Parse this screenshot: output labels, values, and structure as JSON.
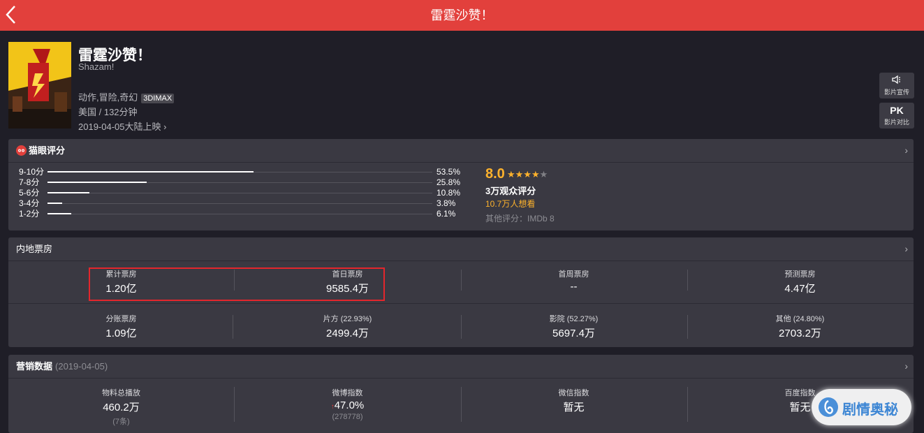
{
  "header": {
    "title": "雷霆沙赞！"
  },
  "movie": {
    "title": "雷霆沙赞！",
    "title_en": "Shazam!",
    "genres": "动作,冒险,奇幻",
    "format_badge": "3DIMAX",
    "country_duration": "美国 / 132分钟",
    "release": "2019-04-05大陆上映 ›"
  },
  "side_buttons": [
    {
      "icon": "🔈",
      "label": "影片宣传"
    },
    {
      "icon": "PK",
      "label": "影片对比"
    }
  ],
  "rating": {
    "section_title": "猫眼评分",
    "distribution": [
      {
        "label": "9-10分",
        "pct": "53.5%",
        "value": 53.5
      },
      {
        "label": "7-8分",
        "pct": "25.8%",
        "value": 25.8
      },
      {
        "label": "5-6分",
        "pct": "10.8%",
        "value": 10.8
      },
      {
        "label": "3-4分",
        "pct": "3.8%",
        "value": 3.8
      },
      {
        "label": "1-2分",
        "pct": "6.1%",
        "value": 6.1
      }
    ],
    "score": "8.0",
    "stars_filled": 4,
    "stars_total": 5,
    "audience": "3万观众评分",
    "want_to_see": "10.7万人想看",
    "other_rating": "其他评分：IMDb 8"
  },
  "box_office": {
    "section_title": "内地票房",
    "row1": [
      {
        "label": "累计票房",
        "value": "1.20亿"
      },
      {
        "label": "首日票房",
        "value": "9585.4万"
      },
      {
        "label": "首周票房",
        "value": "--"
      },
      {
        "label": "预测票房",
        "value": "4.47亿"
      }
    ],
    "row2": [
      {
        "label": "分账票房",
        "value": "1.09亿"
      },
      {
        "label": "片方 (22.93%)",
        "value": "2499.4万"
      },
      {
        "label": "影院 (52.27%)",
        "value": "5697.4万"
      },
      {
        "label": "其他 (24.80%)",
        "value": "2703.2万"
      }
    ]
  },
  "marketing": {
    "section_title": "营销数据",
    "date": "(2019-04-05)",
    "items": [
      {
        "label": "物料总播放",
        "value": "460.2万",
        "sub": "(7条)"
      },
      {
        "label": "微博指数",
        "value": "47.0%",
        "sub": "(278778)",
        "arrow": "↑"
      },
      {
        "label": "微信指数",
        "value": "暂无",
        "sub": ""
      },
      {
        "label": "百度指数",
        "value": "暂无",
        "sub": ""
      }
    ]
  },
  "watermark": {
    "text": "剧情奥秘"
  },
  "colors": {
    "topbar": "#e2403c",
    "background": "#1f1e27",
    "panel": "#3a3942",
    "accent_gold": "#fdb22c",
    "highlight_box": "#e3262c"
  }
}
